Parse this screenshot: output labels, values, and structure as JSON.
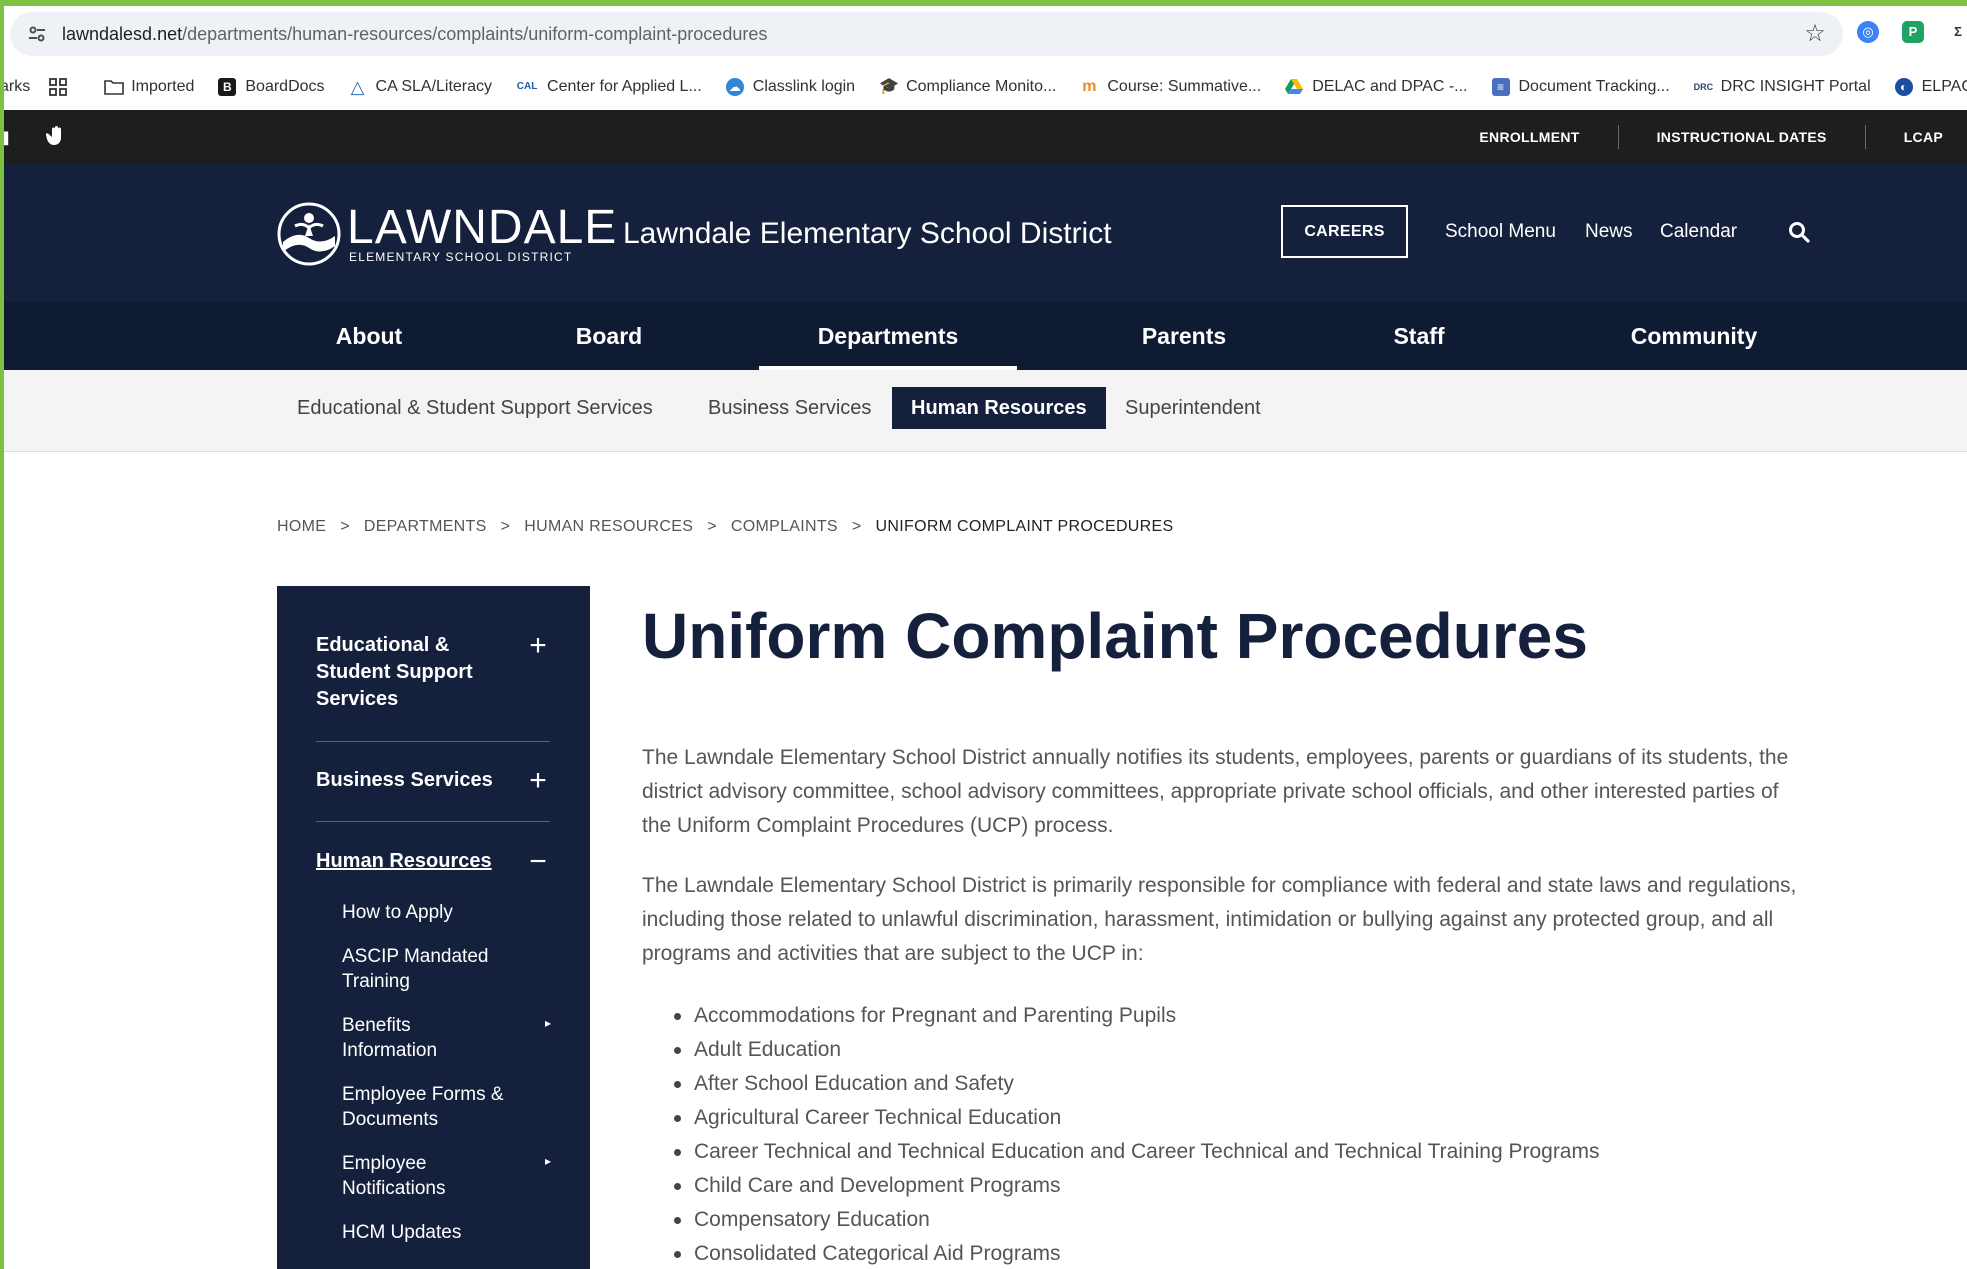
{
  "browser": {
    "url_domain": "lawndalesd.net",
    "url_path": "/departments/human-resources/complaints/uniform-complaint-procedures",
    "bookmarks_partial": "arks",
    "bookmarks": [
      {
        "label": "Imported",
        "icon": "folder-icon"
      },
      {
        "label": "BoardDocs",
        "icon": "boarddocs-icon",
        "color": "#1a1a1a"
      },
      {
        "label": "CA SLA/Literacy",
        "icon": "triangle-icon",
        "color": "#2b6cb0"
      },
      {
        "label": "Center for Applied L...",
        "icon": "cal-icon",
        "color": "#1e5aa8"
      },
      {
        "label": "Classlink login",
        "icon": "cloud-icon",
        "color": "#2f86d6"
      },
      {
        "label": "Compliance Monito...",
        "icon": "graduation-cap-icon",
        "color": "#333333"
      },
      {
        "label": "Course: Summative...",
        "icon": "moodle-icon",
        "color": "#f08a24"
      },
      {
        "label": "DELAC and DPAC -...",
        "icon": "google-drive-icon",
        "color": "#0f9d58"
      },
      {
        "label": "Document Tracking...",
        "icon": "docs-icon",
        "color": "#4a6fc0"
      },
      {
        "label": "DRC INSIGHT Portal",
        "icon": "drc-icon",
        "color": "#2c3e74"
      },
      {
        "label": "ELPAC Hom",
        "icon": "elpac-icon",
        "color": "#1b4f9c"
      }
    ]
  },
  "utility": {
    "links": [
      "ENROLLMENT",
      "INSTRUCTIONAL DATES",
      "LCAP"
    ]
  },
  "header": {
    "logo_word": "LAWNDALE",
    "logo_sub": "ELEMENTARY SCHOOL DISTRICT",
    "district_name": "Lawndale Elementary School District",
    "careers": "CAREERS",
    "links": [
      "School Menu",
      "News",
      "Calendar"
    ]
  },
  "mainnav": {
    "items": [
      "About",
      "Board",
      "Departments",
      "Parents",
      "Staff",
      "Community"
    ],
    "active": "Departments"
  },
  "subnav": {
    "items": [
      "Educational & Student Support Services",
      "Business Services",
      "Human Resources",
      "Superintendent"
    ],
    "active": "Human Resources"
  },
  "breadcrumb": [
    "HOME",
    "DEPARTMENTS",
    "HUMAN RESOURCES",
    "COMPLAINTS",
    "UNIFORM COMPLAINT PROCEDURES"
  ],
  "sidebar": {
    "sections": [
      {
        "line1": "Educational &",
        "line2": "Student Support",
        "line3": "Services",
        "toggle": "+"
      },
      {
        "label": "Business Services",
        "toggle": "+"
      },
      {
        "label": "Human Resources",
        "toggle": "−"
      }
    ],
    "subitems": [
      {
        "line1": "How to Apply",
        "line2": ""
      },
      {
        "line1": "ASCIP Mandated",
        "line2": "Training"
      },
      {
        "line1": "Benefits",
        "line2": "Information",
        "has_caret": true
      },
      {
        "line1": "Employee Forms &",
        "line2": "Documents"
      },
      {
        "line1": "Employee",
        "line2": "Notifications",
        "has_caret": true
      },
      {
        "line1": "HCM Updates",
        "line2": ""
      }
    ]
  },
  "content": {
    "title": "Uniform Complaint Procedures",
    "para1": "The Lawndale Elementary School District annually notifies its students, employees, parents or guardians of its students, the district advisory committee, school advisory committees, appropriate private school officials, and other interested parties of the Uniform Complaint Procedures (UCP) process.",
    "para2": "The Lawndale Elementary School District is primarily responsible for compliance with federal and state laws and regulations, including those related to unlawful discrimination, harassment, intimidation or bullying against any protected group, and all programs and activities that are subject to the UCP in:",
    "programs": [
      "Accommodations for Pregnant and Parenting Pupils",
      "Adult Education",
      "After School Education and Safety",
      "Agricultural Career Technical Education",
      "Career Technical and Technical Education and Career Technical and Technical Training Programs",
      "Child Care and Development Programs",
      "Compensatory Education",
      "Consolidated Categorical Aid Programs"
    ]
  },
  "colors": {
    "navy": "#15203d",
    "nav_dark": "#0f1a33",
    "utility_bg": "#1e1e1e",
    "outer_border": "#7cc242"
  }
}
